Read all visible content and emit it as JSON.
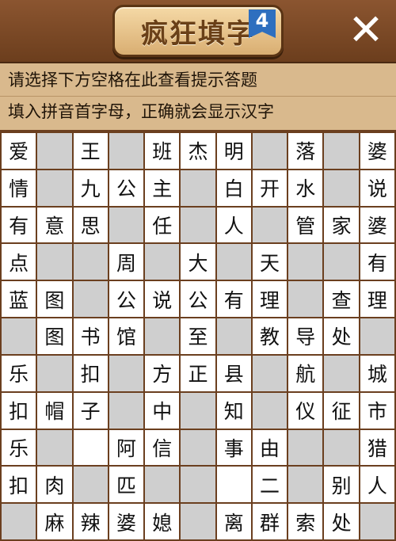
{
  "header": {
    "title": "疯狂填字",
    "level": "4",
    "close_label": "✕"
  },
  "hint": {
    "line1": "请选择下方空格在此查看提示答题",
    "line2": "填入拼音首字母，正确就会显示汉字"
  },
  "grid": [
    [
      "爱",
      "",
      "王",
      "",
      "班",
      "杰",
      "明",
      "",
      "落",
      "",
      "婆"
    ],
    [
      "情",
      "",
      "九",
      "公",
      "主",
      "",
      "白",
      "开",
      "水",
      "",
      "说"
    ],
    [
      "有",
      "意",
      "思",
      "",
      "任",
      "",
      "人",
      "",
      "管",
      "家",
      "婆"
    ],
    [
      "点",
      "",
      "",
      "周",
      "",
      "大",
      "",
      "天",
      "",
      "",
      "有"
    ],
    [
      "蓝",
      "图",
      "",
      "公",
      "说",
      "公",
      "有",
      "理",
      "",
      "查",
      "理"
    ],
    [
      "",
      "图",
      "书",
      "馆",
      "",
      "至",
      "",
      "教",
      "导",
      "处",
      ""
    ],
    [
      "乐",
      "",
      "扣",
      "",
      "方",
      "正",
      "县",
      "",
      "航",
      "",
      "城"
    ],
    [
      "扣",
      "帽",
      "子",
      "",
      "中",
      "",
      "知",
      "",
      "仪",
      "征",
      "市"
    ],
    [
      "乐",
      "",
      "",
      "阿",
      "信",
      "",
      "事",
      "由",
      "",
      "",
      "猎"
    ],
    [
      "扣",
      "肉",
      "",
      "匹",
      "",
      "",
      "",
      "二",
      "",
      "别",
      "人"
    ],
    [
      "",
      "麻",
      "辣",
      "婆",
      "媳",
      "",
      "离",
      "群",
      "索",
      "处",
      ""
    ]
  ],
  "cell_mask": [
    [
      1,
      0,
      1,
      0,
      1,
      1,
      1,
      0,
      1,
      0,
      1
    ],
    [
      1,
      0,
      1,
      1,
      1,
      0,
      1,
      1,
      1,
      0,
      1
    ],
    [
      1,
      1,
      1,
      0,
      1,
      0,
      1,
      0,
      1,
      1,
      1
    ],
    [
      1,
      0,
      0,
      1,
      0,
      1,
      0,
      1,
      0,
      0,
      1
    ],
    [
      1,
      1,
      0,
      1,
      1,
      1,
      1,
      1,
      0,
      1,
      1
    ],
    [
      0,
      1,
      1,
      1,
      0,
      1,
      0,
      1,
      1,
      1,
      0
    ],
    [
      1,
      0,
      1,
      0,
      1,
      1,
      1,
      0,
      1,
      0,
      1
    ],
    [
      1,
      1,
      1,
      0,
      1,
      0,
      1,
      0,
      1,
      1,
      1
    ],
    [
      1,
      0,
      1,
      1,
      1,
      0,
      1,
      1,
      0,
      0,
      1
    ],
    [
      1,
      1,
      0,
      1,
      0,
      0,
      1,
      1,
      0,
      1,
      1
    ],
    [
      0,
      1,
      1,
      1,
      1,
      0,
      1,
      1,
      1,
      1,
      0
    ]
  ]
}
